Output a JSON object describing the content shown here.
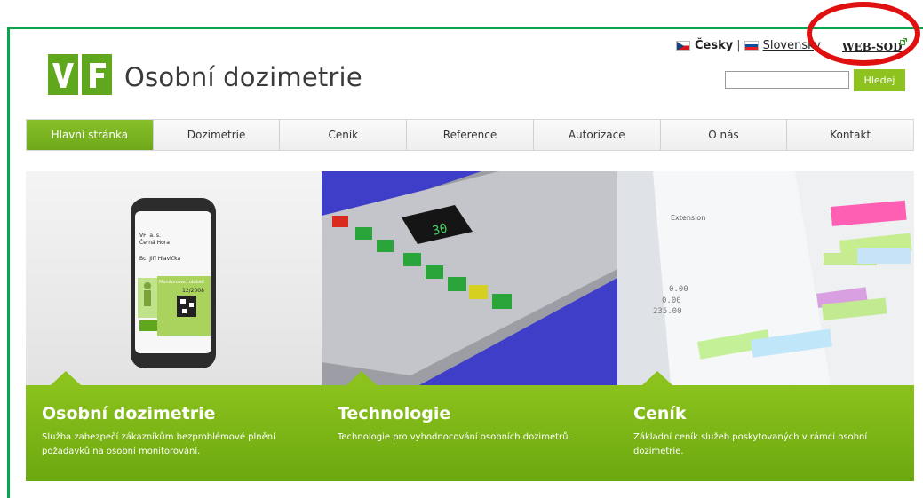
{
  "header": {
    "site_title": "Osobní dozimetrie",
    "logo_letters": [
      "V",
      "F"
    ],
    "brand_color": "#5fa71c"
  },
  "languages": {
    "current": "Česky",
    "separator": "|",
    "other": "Slovensky"
  },
  "websod_link": "WEB-SOD",
  "search": {
    "value": "",
    "placeholder": "",
    "button_label": "Hledej"
  },
  "nav": {
    "items": [
      "Hlavní stránka",
      "Dozimetrie",
      "Ceník",
      "Reference",
      "Autorizace",
      "O nás",
      "Kontakt"
    ],
    "active": 0
  },
  "panels": [
    {
      "title": "Osobní dozimetrie",
      "text": "Služba zabezpečí zákazníkům bezproblémové plnění požadavků na osobní monitorování.",
      "card_text": [
        "VF, a. s.",
        "Černá Hora",
        "Bc. Jiří Hlavička",
        "Monitorovací období",
        "12/2008"
      ]
    },
    {
      "title": "Technologie",
      "text": "Technologie pro vyhodnocování osobních dozimetrů.",
      "display_digits": "30"
    },
    {
      "title": "Ceník",
      "text": "Základní ceník služeb poskytovaných v rámci osobní dozimetrie.",
      "paper_text": [
        "Extension",
        "0.00",
        "0.00",
        "0.00",
        "235.00"
      ]
    }
  ],
  "colors": {
    "accent_green": "#8bc21d",
    "frame_green": "#0aa54a",
    "highlight_red": "#e01010"
  }
}
